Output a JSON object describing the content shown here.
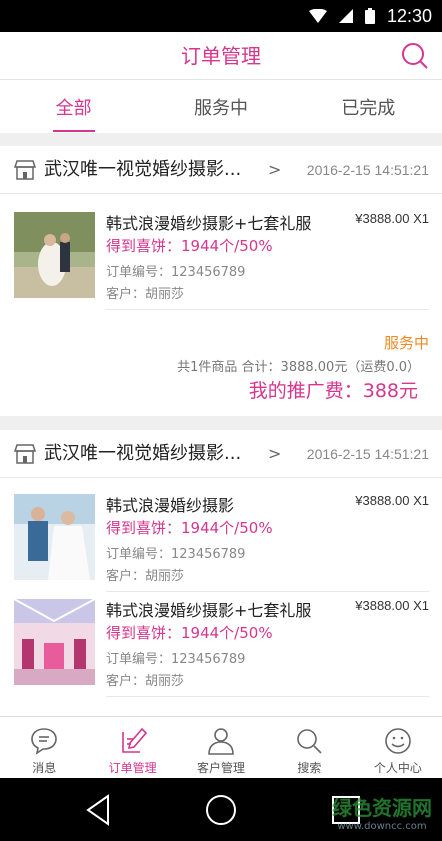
{
  "status_bar": {
    "time": "12:30"
  },
  "header": {
    "title": "订单管理"
  },
  "tabs": [
    {
      "label": "全部",
      "active": true
    },
    {
      "label": "服务中",
      "active": false
    },
    {
      "label": "已完成",
      "active": false
    }
  ],
  "orders": [
    {
      "shop_name": "武汉唯一视觉婚纱摄影...",
      "date": "2016-2-15 14:51:21",
      "items": [
        {
          "title": "韩式浪漫婚纱摄影+七套礼服",
          "price": "¥3888.00 X1",
          "reward": "得到喜饼：1944个/50%",
          "order_no": "订单编号：123456789",
          "customer": "客户：胡丽莎"
        }
      ],
      "status": "服务中",
      "total": "共1件商品  合计：3888.00元（运费0.0）",
      "promo_fee": "我的推广费：388元"
    },
    {
      "shop_name": "武汉唯一视觉婚纱摄影...",
      "date": "2016-2-15 14:51:21",
      "items": [
        {
          "title": "韩式浪漫婚纱摄影",
          "price": "¥3888.00 X1",
          "reward": "得到喜饼：1944个/50%",
          "order_no": "订单编号：123456789",
          "customer": "客户：胡丽莎"
        },
        {
          "title": "韩式浪漫婚纱摄影+七套礼服",
          "price": "¥3888.00 X1",
          "reward": "得到喜饼：1944个/50%",
          "order_no": "订单编号：123456789",
          "customer": "客户：胡丽莎"
        }
      ]
    }
  ],
  "bottom_nav": [
    {
      "label": "消息",
      "icon": "chat-bubble-icon",
      "active": false
    },
    {
      "label": "订单管理",
      "icon": "order-edit-icon",
      "active": true
    },
    {
      "label": "客户管理",
      "icon": "customers-icon",
      "active": false
    },
    {
      "label": "搜索",
      "icon": "search-icon",
      "active": false
    },
    {
      "label": "个人中心",
      "icon": "smiley-icon",
      "active": false
    }
  ],
  "watermark": {
    "text": "绿色资源网",
    "sub": "www.downcc.com"
  },
  "colors": {
    "accent": "#d6368e",
    "status_orange": "#ef8a22",
    "divider": "#efefef"
  }
}
